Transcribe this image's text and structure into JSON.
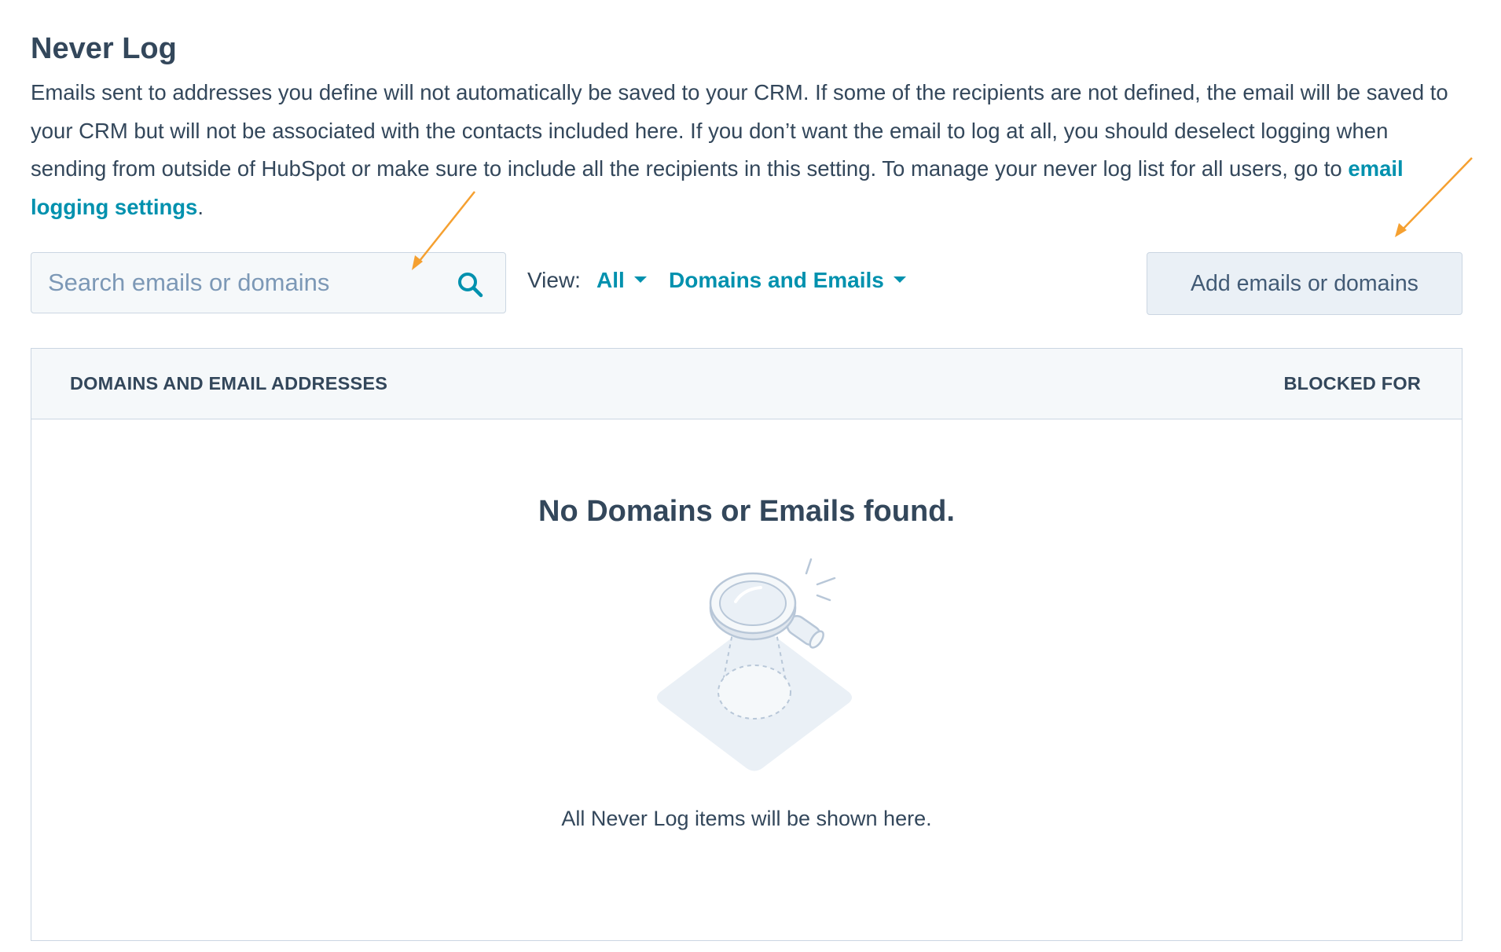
{
  "page": {
    "title": "Never Log",
    "description_text": "Emails sent to addresses you define will not automatically be saved to your CRM. If some of the recipients are not defined, the email will be saved to your CRM but will not be associated with the contacts included here. If you don’t want the email to log at all, you should deselect logging when sending from outside of HubSpot or make sure to include all the recipients in this setting. To manage your never log list for all users, go to ",
    "description_link": "email logging settings",
    "description_end": "."
  },
  "toolbar": {
    "search_placeholder": "Search emails or domains",
    "view_label": "View:",
    "filter_all": "All",
    "filter_type": "Domains and Emails",
    "add_button": "Add emails or domains"
  },
  "table": {
    "columns": [
      "DOMAINS AND EMAIL ADDRESSES",
      "BLOCKED FOR"
    ],
    "rows": [],
    "empty_title": "No Domains or Emails found.",
    "empty_caption": "All Never Log items will be shown here."
  },
  "colors": {
    "text": "#33475b",
    "link": "#0091ae",
    "border": "#cbd6e2",
    "annotation_arrow": "#f5a030"
  },
  "icons": {
    "search": "search-icon",
    "dropdown": "caret-down-icon",
    "empty_state": "magnifying-glass-illustration"
  }
}
